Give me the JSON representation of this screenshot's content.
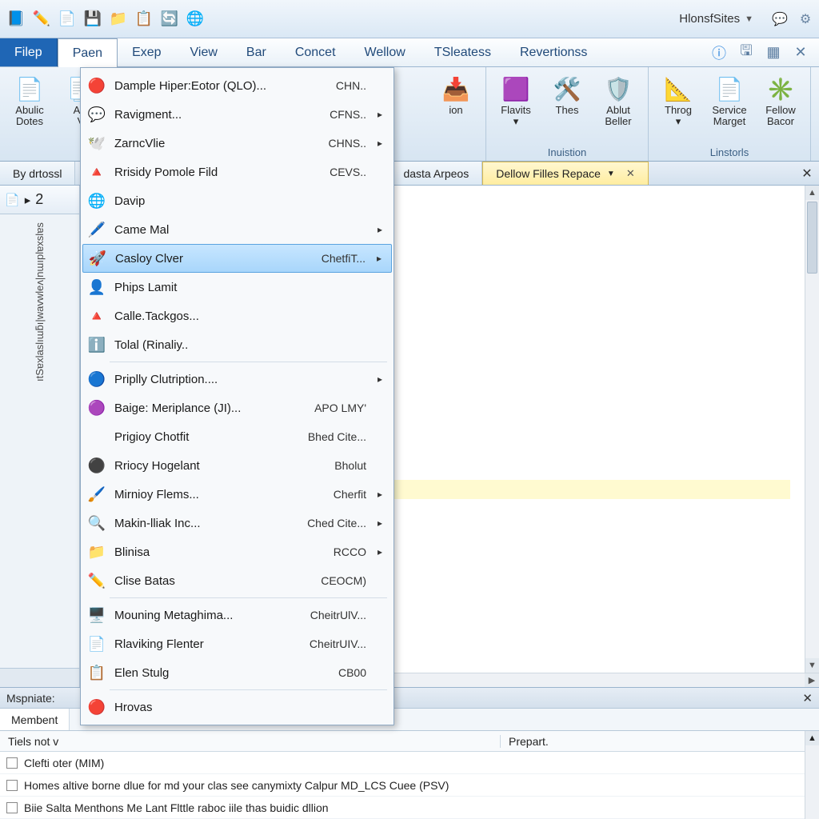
{
  "titlebar": {
    "account": "HlonsfSites"
  },
  "menubar": {
    "items": [
      "Filep",
      "Paen",
      "Exep",
      "View",
      "Bar",
      "Concet",
      "Wellow",
      "TSleatess",
      "Revertionss"
    ],
    "open_index": 1
  },
  "ribbon": {
    "groups": [
      {
        "label": "",
        "buttons": [
          {
            "label": "Abulic\nDotes",
            "icon": "📄",
            "name": "ribbon-abulic-dotes"
          },
          {
            "label": "Ald\nV",
            "icon": "📑",
            "name": "ribbon-ald"
          }
        ]
      },
      {
        "label": "",
        "buttons": [
          {
            "label": "ion",
            "icon": "📥",
            "name": "ribbon-ion"
          }
        ]
      },
      {
        "label": "Inuistion",
        "buttons": [
          {
            "label": "Flavits\n▾",
            "icon": "🟪",
            "name": "ribbon-flavits"
          },
          {
            "label": "Thes",
            "icon": "🛠️",
            "name": "ribbon-thes"
          },
          {
            "label": "Ablut\nBeller",
            "icon": "🛡️",
            "name": "ribbon-ablut-beller"
          }
        ]
      },
      {
        "label": "Linstorls",
        "buttons": [
          {
            "label": "Throg\n▾",
            "icon": "📐",
            "name": "ribbon-throg"
          },
          {
            "label": "Service\nMarget",
            "icon": "📄",
            "name": "ribbon-service-marget"
          },
          {
            "label": "Fellow\nBacor",
            "icon": "✳️",
            "name": "ribbon-fellow-bacor"
          }
        ]
      }
    ]
  },
  "tabs": {
    "items": [
      {
        "label": "By drtossl",
        "active": false
      },
      {
        "label": "dasta Arpeos",
        "active": false
      },
      {
        "label": "Dellow Filles Repace",
        "active": true
      }
    ]
  },
  "leftpanel": {
    "number": "2",
    "vertical_text": "ıtSɐxlaslıɯƃı|wavwleʌ|nɯıplɐxslɐs"
  },
  "dropdown": {
    "items": [
      {
        "icon": "🔴",
        "label": "Dample Hiper:Eotor (QLO)...",
        "shortcut": "CHN..",
        "arrow": false,
        "color": "#c0392b"
      },
      {
        "icon": "💬",
        "label": "Ravigment...",
        "shortcut": "CFNS..",
        "arrow": true,
        "color": "#3a78b5"
      },
      {
        "icon": "🕊️",
        "label": "ZarncVlie",
        "shortcut": "CHNS..",
        "arrow": true,
        "color": "#27ae60"
      },
      {
        "icon": "🔺",
        "label": "Rrisidy Pomole Fild",
        "shortcut": "CEVS..",
        "arrow": false,
        "color": "#8e44ad"
      },
      {
        "icon": "🌐",
        "label": "Davip",
        "shortcut": "",
        "arrow": false,
        "color": "#2980b9"
      },
      {
        "icon": "🖊️",
        "label": "Came Mal",
        "shortcut": "",
        "arrow": true,
        "color": "#e67e22"
      },
      {
        "icon": "🚀",
        "label": "Casloy Clver",
        "shortcut": "ChetfiT...",
        "arrow": true,
        "sel": true,
        "color": "#34495e"
      },
      {
        "icon": "👤",
        "label": "Phips Lamit",
        "shortcut": "",
        "arrow": false,
        "color": "#2c3e50"
      },
      {
        "icon": "🔺",
        "label": "Calle.Tackgos...",
        "shortcut": "",
        "arrow": false,
        "color": "#f1c40f"
      },
      {
        "icon": "ℹ️",
        "label": "Tolal (Rinaliy..",
        "shortcut": "",
        "arrow": false,
        "color": "#2e86de"
      },
      {
        "sep": true
      },
      {
        "icon": "🔵",
        "label": "Priplly Clutription....",
        "shortcut": "",
        "arrow": true,
        "color": "#3498db"
      },
      {
        "icon": "🟣",
        "label": "Baige: Meriplance (JI)...",
        "shortcut": "APO LMY'",
        "arrow": false,
        "color": "#9b59b6"
      },
      {
        "icon": "",
        "label": "Prigioy Chotfit",
        "shortcut": "Bhed Cite...",
        "arrow": false
      },
      {
        "icon": "⚫",
        "label": "Rriocy Hogelant",
        "shortcut": "Bholut",
        "arrow": false,
        "color": "#2c3e50"
      },
      {
        "icon": "🖌️",
        "label": "Mirnioy Flems...",
        "shortcut": "Cherfit",
        "arrow": true,
        "color": "#c0392b"
      },
      {
        "icon": "🔍",
        "label": "Makin-lliak Inc...",
        "shortcut": "Ched Cite...",
        "arrow": true,
        "color": "#2e86de"
      },
      {
        "icon": "📁",
        "label": "Blinisa",
        "shortcut": "RCCO",
        "arrow": true,
        "color": "#f39c12"
      },
      {
        "icon": "✏️",
        "label": "Clise Batas",
        "shortcut": "CEOCM)",
        "arrow": false,
        "color": "#d35400"
      },
      {
        "sep": true
      },
      {
        "icon": "🖥️",
        "label": "Mouning Metaghima...",
        "shortcut": "CheitrUlV...",
        "arrow": false,
        "color": "#34495e"
      },
      {
        "icon": "📄",
        "label": "Rlaviking Flenter",
        "shortcut": "CheitrUIV...",
        "arrow": false,
        "color": "#7f8c8d"
      },
      {
        "icon": "📋",
        "label": "Elen Stulg",
        "shortcut": "CB00",
        "arrow": false,
        "color": "#95a5a6"
      },
      {
        "sep": true
      },
      {
        "icon": "🔴",
        "label": "Hrovas",
        "shortcut": "",
        "arrow": false,
        "color": "#c0392b"
      }
    ]
  },
  "bottom": {
    "header": "Mspniate:",
    "tab": "Membent",
    "col1": "Tiels not v",
    "col2": "Prepart.",
    "rows": [
      "Clefti                                                                              oter (MIM)",
      "Homes altive borne dlue for md your clas see canymixty Calpur MD_LCS Cuee (PSV)",
      "Biie Salta Menthons Me Lant Flttle raboc iile thas buidic dllion"
    ]
  }
}
